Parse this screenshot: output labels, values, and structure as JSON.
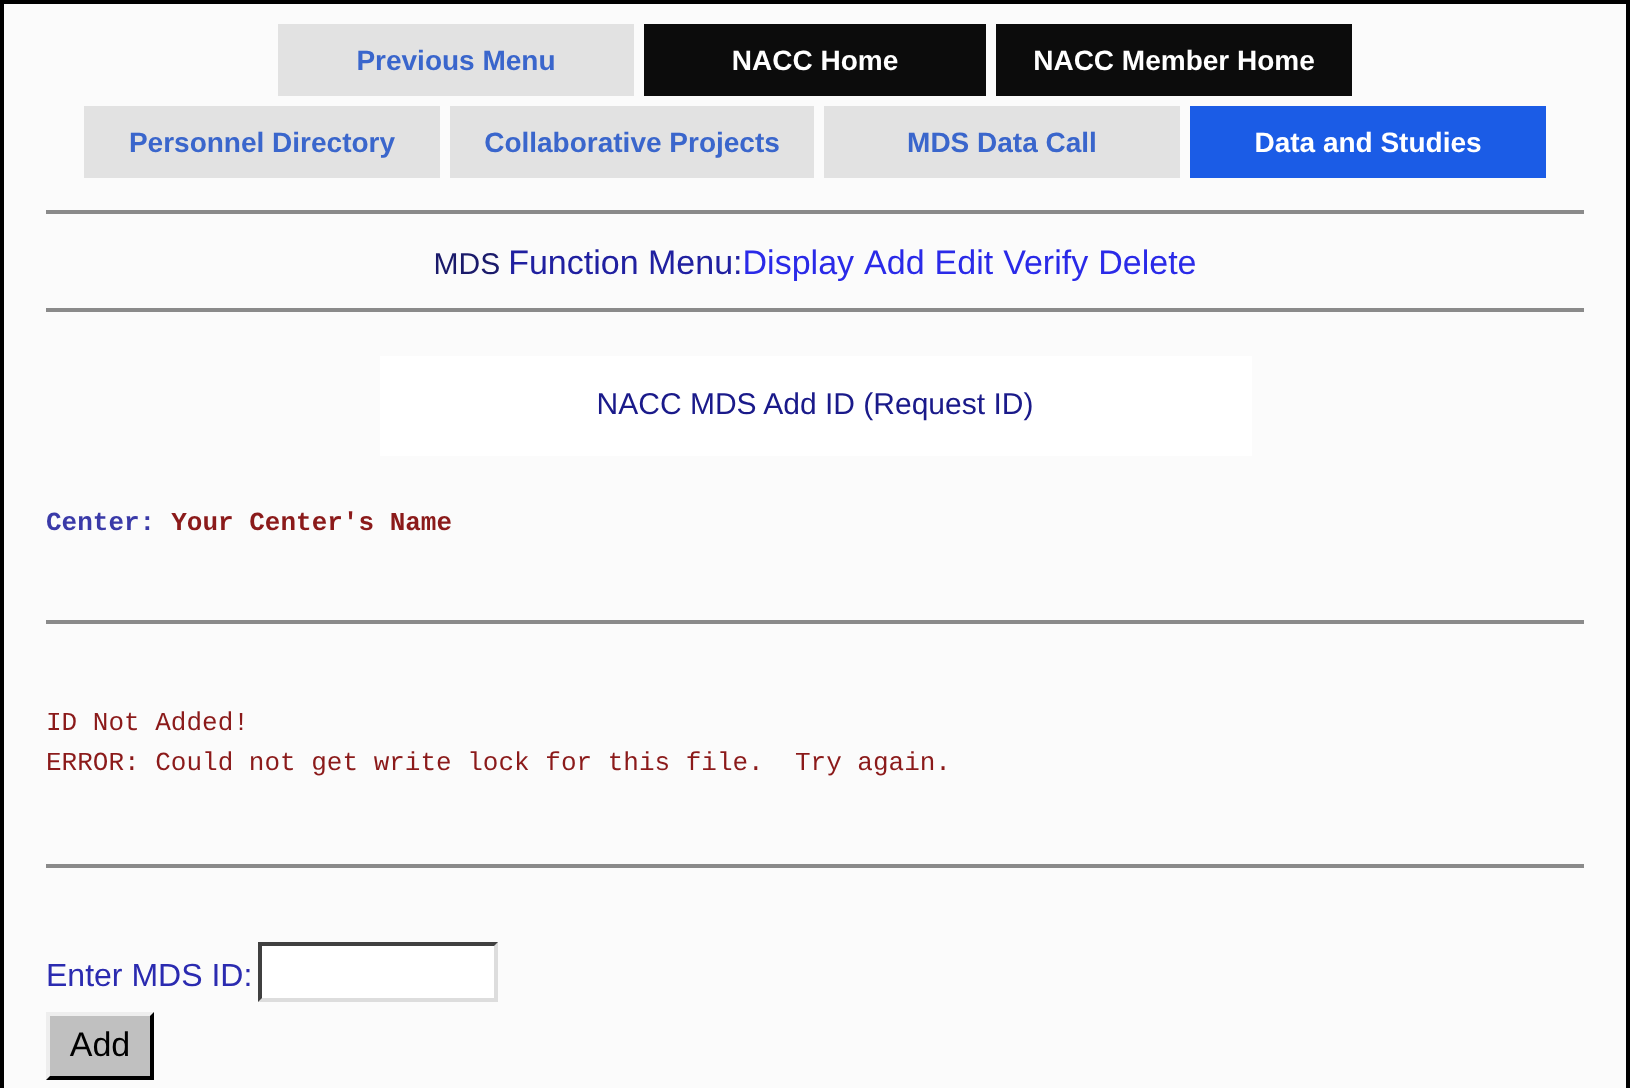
{
  "nav_rows": [
    [
      {
        "label": "Previous Menu",
        "kind": "standard",
        "selected": false
      },
      {
        "label": "NACC Home",
        "kind": "home",
        "selected": false
      },
      {
        "label": "NACC Member Home",
        "kind": "home",
        "selected": false
      }
    ],
    [
      {
        "label": "Personnel Directory",
        "kind": "standard",
        "selected": false
      },
      {
        "label": "Collaborative Projects",
        "kind": "standard",
        "selected": false
      },
      {
        "label": "MDS Data Call",
        "kind": "standard",
        "selected": false
      },
      {
        "label": "Data and Studies",
        "kind": "standard",
        "selected": true
      }
    ]
  ],
  "function_menu": {
    "prefix": "MDS",
    "label": "Function Menu:",
    "links": [
      "Display",
      "Add",
      "Edit",
      "Verify",
      "Delete"
    ]
  },
  "title": "NACC MDS Add ID (Request ID)",
  "center": {
    "label": "Center:",
    "value": "Your Center's Name"
  },
  "messages": [
    "ID Not Added!",
    "ERROR: Could not get write lock for this file.  Try again."
  ],
  "form": {
    "label": "Enter MDS ID:",
    "button": "Add"
  }
}
